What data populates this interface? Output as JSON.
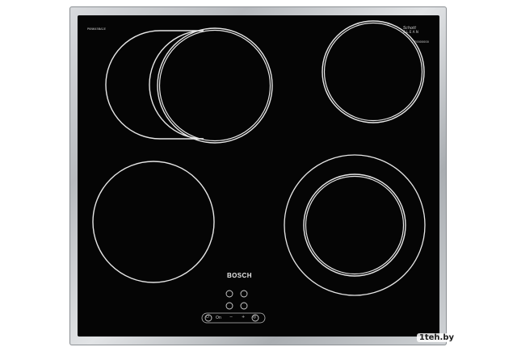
{
  "product": {
    "brand": "BOSCH",
    "model_code": "PKN645BA1E",
    "serial_code": "E0000000",
    "clean_line1": "Schott",
    "clean_line2": "CLEAN"
  },
  "controls": {
    "power_symbol": "⏻",
    "on_label": "On",
    "minus_label": "−",
    "plus_label": "+",
    "timer_symbol": "◎"
  },
  "watermark": {
    "text": "1teh.by"
  },
  "colors": {
    "glass": "#050505",
    "frame": "#b7babe",
    "ring": "#e6e6e6"
  }
}
